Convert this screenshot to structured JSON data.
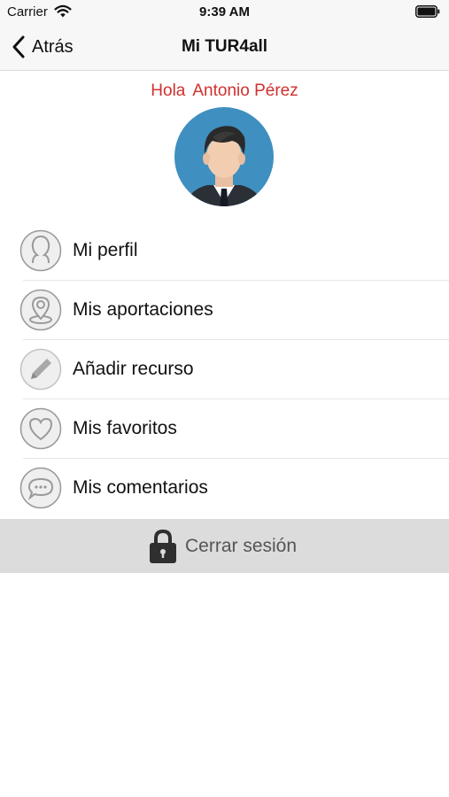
{
  "status_bar": {
    "carrier": "Carrier",
    "time": "9:39 AM"
  },
  "nav": {
    "back_label": "Atrás",
    "title": "Mi TUR4all"
  },
  "greeting": {
    "hello": "Hola",
    "name": "Antonio Pérez"
  },
  "menu": [
    {
      "label": "Mi perfil",
      "icon": "user-icon"
    },
    {
      "label": "Mis aportaciones",
      "icon": "map-pin-icon"
    },
    {
      "label": "Añadir recurso",
      "icon": "pencil-icon"
    },
    {
      "label": "Mis favoritos",
      "icon": "heart-icon"
    },
    {
      "label": "Mis comentarios",
      "icon": "chat-bubble-icon"
    }
  ],
  "logout": {
    "label": "Cerrar sesión",
    "icon": "lock-icon"
  },
  "colors": {
    "accent": "#d0312d",
    "avatar_bg": "#3f8fc0",
    "icon_gray": "#9a9a9a",
    "logout_bg": "#dcdcdc"
  }
}
